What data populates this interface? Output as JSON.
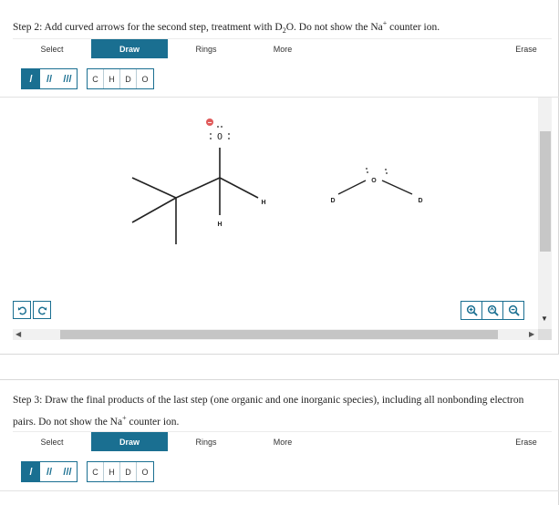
{
  "step2": {
    "title_pre": "Step 2: Add curved arrows for the second step, treatment with D",
    "title_sub": "2",
    "title_mid": "O. Do not show the Na",
    "title_sup": "+",
    "title_post": " counter ion.",
    "tabs": [
      "Select",
      "Draw",
      "Rings",
      "More",
      "Erase"
    ],
    "active_tab": "Draw",
    "bond_tools": [
      "/",
      "//",
      "///"
    ],
    "atom_tools": [
      "C",
      "H",
      "D",
      "O"
    ],
    "molecule1": {
      "alkoxide_O": "O",
      "charge": "−",
      "H_right": "H",
      "H_below": "H"
    },
    "molecule2": {
      "O": "O",
      "D_left": "D",
      "D_right": "D"
    },
    "undo_icons": [
      "undo-icon",
      "redo-icon"
    ],
    "zoom_icons": [
      "zoom-in-icon",
      "zoom-reset-icon",
      "zoom-out-icon"
    ]
  },
  "step3": {
    "title_line1": "Step 3: Draw the final products of the last step (one organic and one inorganic species), including all nonbonding electron",
    "title_line2_pre": "pairs. Do not show the Na",
    "title_line2_sup": "+",
    "title_line2_post": " counter ion.",
    "tabs": [
      "Select",
      "Draw",
      "Rings",
      "More",
      "Erase"
    ],
    "active_tab": "Draw",
    "bond_tools": [
      "/",
      "//",
      "///"
    ],
    "atom_tools": [
      "C",
      "H",
      "D",
      "O"
    ]
  },
  "colors": {
    "accent": "#1a6f91",
    "charge": "#e05a5a"
  }
}
